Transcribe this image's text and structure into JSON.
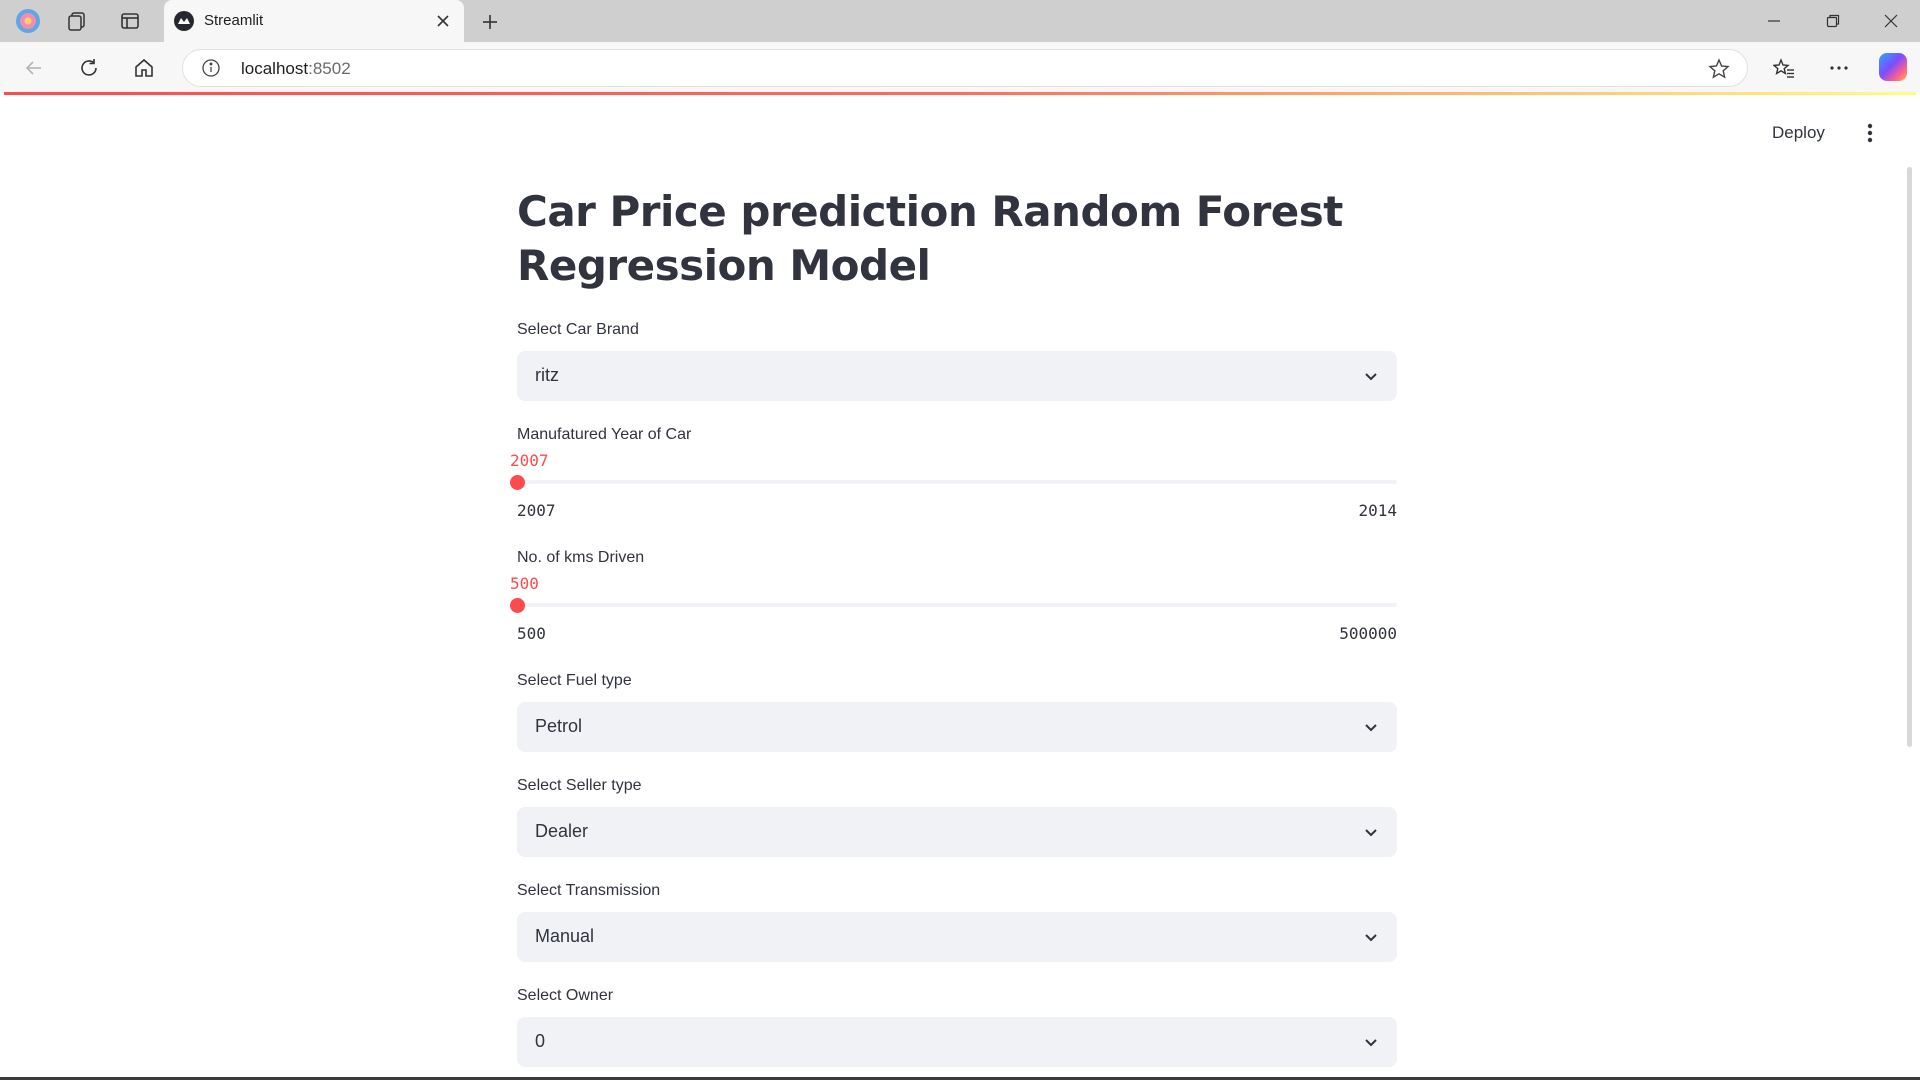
{
  "browser": {
    "tab_title": "Streamlit",
    "address_host": "localhost",
    "address_port": ":8502"
  },
  "app": {
    "deploy_label": "Deploy",
    "title": "Car Price prediction Random Forest Regression Model",
    "car_brand": {
      "label": "Select Car Brand",
      "value": "ritz"
    },
    "year_slider": {
      "label": "Manufatured Year of Car",
      "value": "2007",
      "min": "2007",
      "max": "2014",
      "fraction": 0
    },
    "kms_slider": {
      "label": "No. of kms Driven",
      "value": "500",
      "min": "500",
      "max": "500000",
      "fraction": 0
    },
    "fuel_type": {
      "label": "Select Fuel type",
      "value": "Petrol"
    },
    "seller_type": {
      "label": "Select Seller type",
      "value": "Dealer"
    },
    "transmission": {
      "label": "Select Transmission",
      "value": "Manual"
    },
    "owner": {
      "label": "Select Owner",
      "value": "0"
    }
  },
  "colors": {
    "accent": "#ff4b4b",
    "input_bg": "#f0f2f6",
    "text": "#31333f"
  },
  "icons": [
    "browser-profile-icon",
    "workspaces-icon",
    "tab-actions-icon",
    "streamlit-favicon",
    "close-icon",
    "plus-icon",
    "minimize-icon",
    "restore-icon",
    "window-close-icon",
    "back-icon",
    "refresh-icon",
    "home-icon",
    "info-icon",
    "star-icon",
    "favorites-icon",
    "more-icon",
    "copilot-icon",
    "kebab-menu-icon",
    "chevron-down-icon"
  ]
}
